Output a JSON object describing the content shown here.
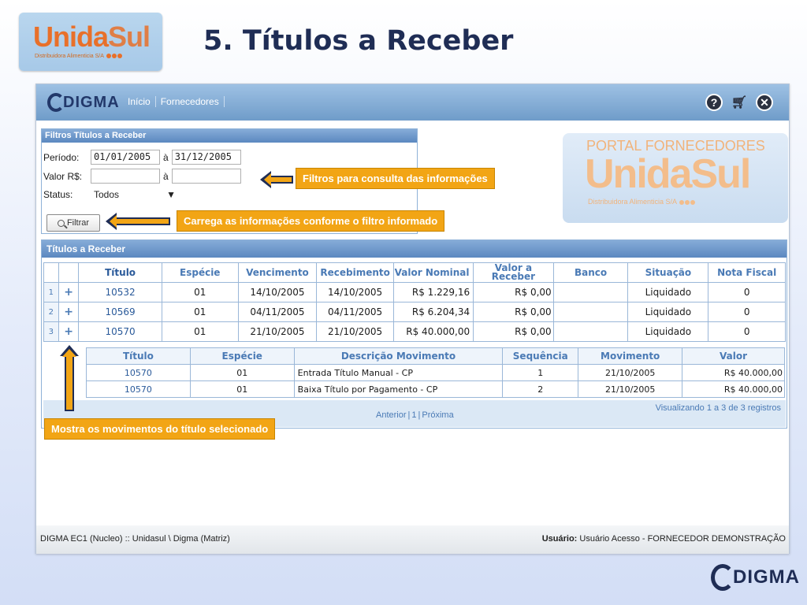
{
  "slide": {
    "logo_word_a": "Unida",
    "logo_word_b": "Sul",
    "logo_sub": "Distribuidora Alimenticia S/A",
    "title": "5. Títulos a Receber",
    "corner_brand": "DIGMA"
  },
  "app": {
    "brand": "DIGMA",
    "nav": [
      "Início",
      "Fornecedores"
    ],
    "icons": [
      "help-icon",
      "cart-icon",
      "close-icon"
    ]
  },
  "filters": {
    "header": "Filtros Títulos a Receber",
    "periodo_label": "Período:",
    "periodo_from": "01/01/2005",
    "periodo_sep": "à",
    "periodo_to": "31/12/2005",
    "valor_label": "Valor R$:",
    "valor_from": "",
    "valor_sep": "à",
    "valor_to": "",
    "status_label": "Status:",
    "status_value": "Todos",
    "button": "Filtrar"
  },
  "callouts": {
    "filters": "Filtros para consulta das informações",
    "load": "Carrega as informações conforme o filtro informado",
    "movements": "Mostra os movimentos do título selecionado"
  },
  "portal": {
    "title": "PORTAL FORNECEDORES",
    "word": "UnidaSul",
    "sub": "Distribuidora Alimenticia S/A"
  },
  "results": {
    "header": "Títulos a Receber",
    "columns": [
      "Título",
      "Espécie",
      "Vencimento",
      "Recebimento",
      "Valor Nominal",
      "Valor a Receber",
      "Banco",
      "Situação",
      "Nota Fiscal"
    ],
    "rows": [
      {
        "idx": "1",
        "toggle": "+",
        "titulo": "10532",
        "especie": "01",
        "vencimento": "14/10/2005",
        "recebimento": "14/10/2005",
        "valor_nominal": "R$ 1.229,16",
        "valor_receber": "R$ 0,00",
        "banco": "",
        "situacao": "Liquidado",
        "nota": "0"
      },
      {
        "idx": "2",
        "toggle": "+",
        "titulo": "10569",
        "especie": "01",
        "vencimento": "04/11/2005",
        "recebimento": "04/11/2005",
        "valor_nominal": "R$ 6.204,34",
        "valor_receber": "R$ 0,00",
        "banco": "",
        "situacao": "Liquidado",
        "nota": "0"
      },
      {
        "idx": "3",
        "toggle": "+",
        "titulo": "10570",
        "especie": "01",
        "vencimento": "21/10/2005",
        "recebimento": "21/10/2005",
        "valor_nominal": "R$ 40.000,00",
        "valor_receber": "R$ 0,00",
        "banco": "",
        "situacao": "Liquidado",
        "nota": "0"
      }
    ],
    "sub_columns": [
      "Título",
      "Espécie",
      "Descrição Movimento",
      "Sequência",
      "Movimento",
      "Valor"
    ],
    "sub_rows": [
      {
        "titulo": "10570",
        "especie": "01",
        "descricao": "Entrada Título Manual - CP",
        "sequencia": "1",
        "movimento": "21/10/2005",
        "valor": "R$ 40.000,00"
      },
      {
        "titulo": "10570",
        "especie": "01",
        "descricao": "Baixa Título por Pagamento - CP",
        "sequencia": "2",
        "movimento": "21/10/2005",
        "valor": "R$ 40.000,00"
      }
    ],
    "pager_prev": "Anterior",
    "pager_page": "1",
    "pager_next": "Próxima",
    "records": "Visualizando 1 a 3 de 3 registros"
  },
  "footer": {
    "left": "DIGMA EC1 (Nucleo) :: Unidasul \\ Digma (Matriz)",
    "user_label": "Usuário:",
    "user_value": "Usuário Acesso - FORNECEDOR DEMONSTRAÇÃO"
  }
}
